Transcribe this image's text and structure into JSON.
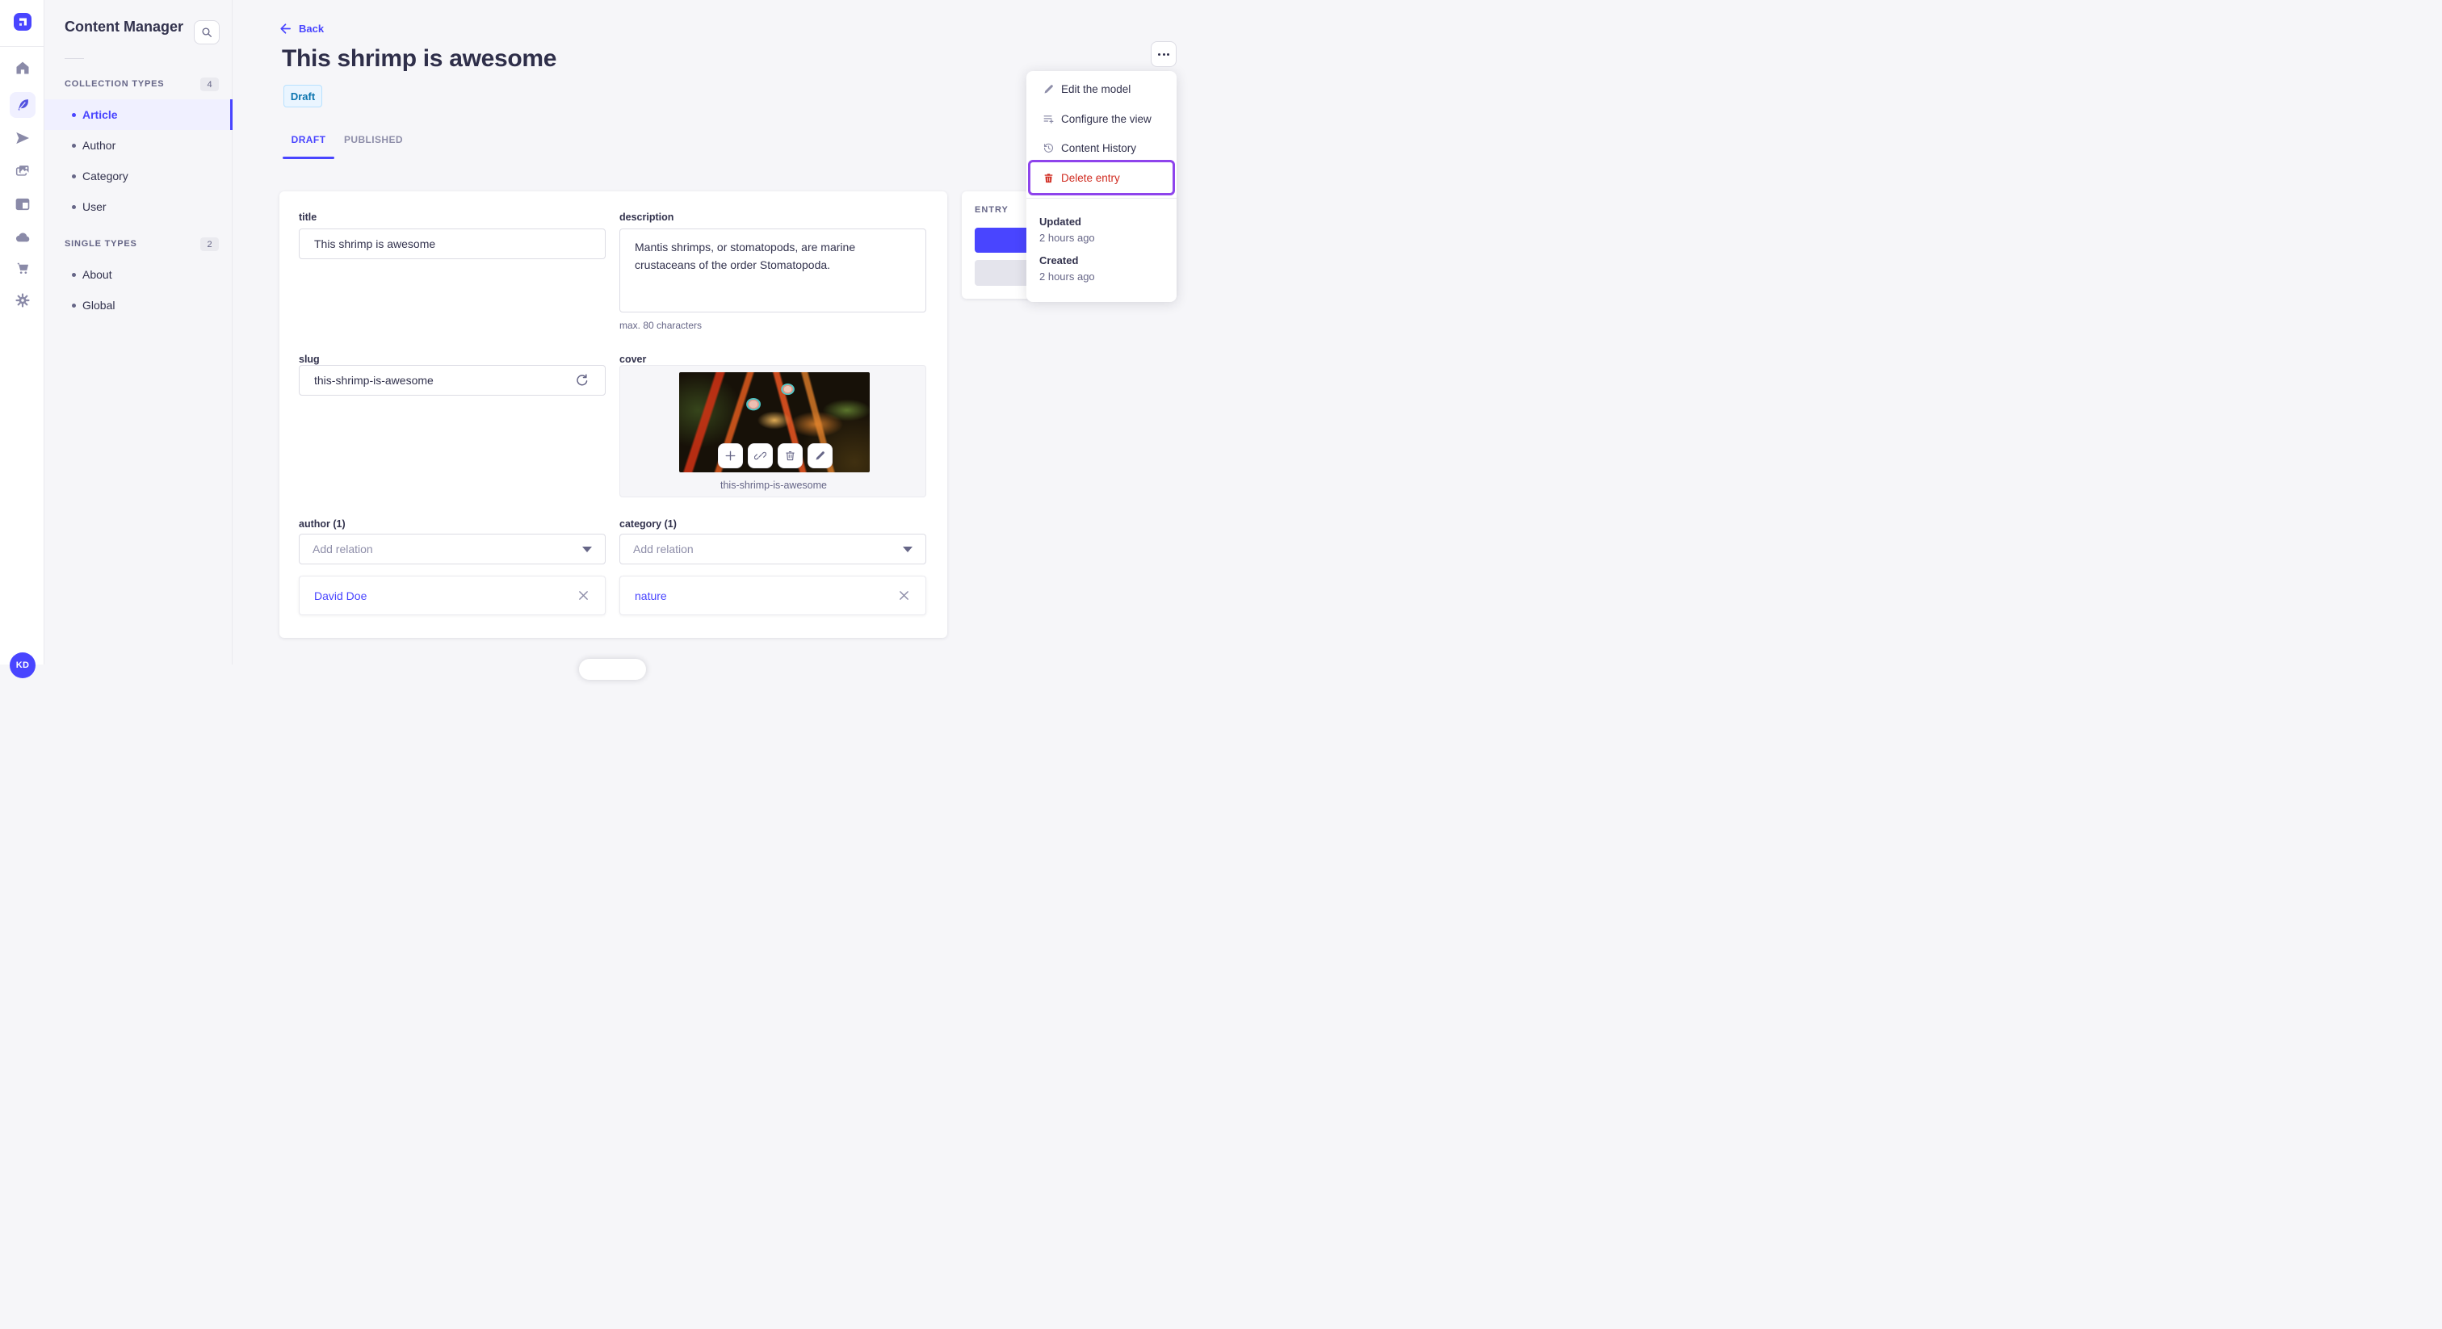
{
  "colors": {
    "accent": "#4945ff",
    "accent_light": "#f0f0ff",
    "danger": "#d02b20",
    "focus_purple": "#8e44ec",
    "draft_badge_bg": "#eaf5ff",
    "draft_badge_text": "#0c75af"
  },
  "rail": {
    "logo_icon": "strapi-logo",
    "icons": [
      "home-icon",
      "feather-icon",
      "send-icon",
      "media-icon",
      "layout-icon",
      "cloud-icon",
      "cart-icon",
      "gear-icon"
    ],
    "active_icon": "feather-icon",
    "avatar_initials": "KD"
  },
  "nav": {
    "title": "Content Manager",
    "search_icon": "search-icon",
    "sections": [
      {
        "label": "COLLECTION TYPES",
        "badge": "4",
        "items": [
          {
            "label": "Article",
            "active": true
          },
          {
            "label": "Author"
          },
          {
            "label": "Category"
          },
          {
            "label": "User"
          }
        ]
      },
      {
        "label": "SINGLE TYPES",
        "badge": "2",
        "items": [
          {
            "label": "About"
          },
          {
            "label": "Global"
          }
        ]
      }
    ]
  },
  "header": {
    "back_label": "Back",
    "back_icon": "arrow-left-icon",
    "title": "This shrimp is awesome",
    "status_badge": "Draft",
    "more_icon": "ellipsis-icon",
    "tabs": [
      {
        "label": "DRAFT",
        "active": true
      },
      {
        "label": "PUBLISHED"
      }
    ]
  },
  "form": {
    "title": {
      "label": "title",
      "value": "This shrimp is awesome"
    },
    "description": {
      "label": "description",
      "value": "Mantis shrimps, or stomatopods, are marine crustaceans of the order Stomatopoda.",
      "hint": "max. 80 characters"
    },
    "slug": {
      "label": "slug",
      "value": "this-shrimp-is-awesome",
      "icon": "regenerate-icon"
    },
    "cover": {
      "label": "cover",
      "caption": "this-shrimp-is-awesome",
      "action_icons": [
        "plus-icon",
        "link-icon",
        "trash-icon",
        "pencil-icon"
      ]
    },
    "author": {
      "label": "author (1)",
      "placeholder": "Add relation",
      "selected": "David Doe",
      "remove_icon": "close-icon"
    },
    "category": {
      "label": "category (1)",
      "placeholder": "Add relation",
      "selected": "nature",
      "remove_icon": "close-icon"
    }
  },
  "entry_panel": {
    "title": "ENTRY"
  },
  "menu": {
    "items": [
      {
        "label": "Edit the model",
        "icon": "pencil-icon"
      },
      {
        "label": "Configure the view",
        "icon": "configure-icon"
      },
      {
        "label": "Content History",
        "icon": "history-icon"
      },
      {
        "label": "Delete entry",
        "icon": "trash-icon",
        "danger": true,
        "focused": true
      }
    ],
    "meta": [
      {
        "label": "Updated",
        "value": "2 hours ago"
      },
      {
        "label": "Created",
        "value": "2 hours ago"
      }
    ]
  }
}
